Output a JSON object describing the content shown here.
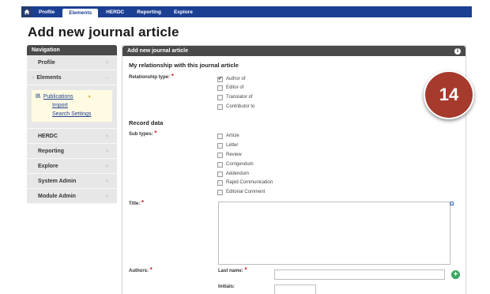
{
  "topnav": {
    "tabs": [
      {
        "label": "Profile"
      },
      {
        "label": "Elements"
      },
      {
        "label": "HERDC"
      },
      {
        "label": "Reporting"
      },
      {
        "label": "Explore"
      }
    ]
  },
  "page_title": "Add new journal article",
  "navigation": {
    "header": "Navigation",
    "items": [
      {
        "label": "Profile"
      },
      {
        "label": "Elements"
      },
      {
        "label": "HERDC"
      },
      {
        "label": "Reporting"
      },
      {
        "label": "Explore"
      },
      {
        "label": "System Admin"
      },
      {
        "label": "Module Admin"
      }
    ],
    "elements_sub": {
      "publications": "Publications",
      "import": "Import",
      "search_settings": "Search Settings"
    },
    "plus_glyph": "+",
    "minus_glyph": "–"
  },
  "main": {
    "header": "Add new journal article",
    "relationship": {
      "section_title": "My relationship with this journal article",
      "label": "Relationship type:",
      "options": [
        {
          "label": "Author of",
          "checked": true
        },
        {
          "label": "Editor of",
          "checked": false
        },
        {
          "label": "Translator of",
          "checked": false
        },
        {
          "label": "Contributor to",
          "checked": false
        }
      ]
    },
    "record": {
      "section_title": "Record data",
      "subtypes_label": "Sub types:",
      "subtypes": [
        {
          "label": "Article"
        },
        {
          "label": "Letter"
        },
        {
          "label": "Review"
        },
        {
          "label": "Corrigendum"
        },
        {
          "label": "Addendum"
        },
        {
          "label": "Rapid Communication"
        },
        {
          "label": "Editorial Comment"
        }
      ],
      "title_label": "Title:",
      "title_value": "",
      "authors_label": "Authors:",
      "last_name_label": "Last name:",
      "last_name_value": "",
      "initials_label": "Initials:",
      "initials_value": ""
    },
    "required_glyph": "*",
    "omega_glyph": "Ω"
  },
  "badge": {
    "text": "14",
    "color": "#a63a2d"
  },
  "colors": {
    "topbar": "#1b3f93",
    "panel_header": "#4a4a4a",
    "required": "#d31f1f",
    "add": "#39a561"
  }
}
